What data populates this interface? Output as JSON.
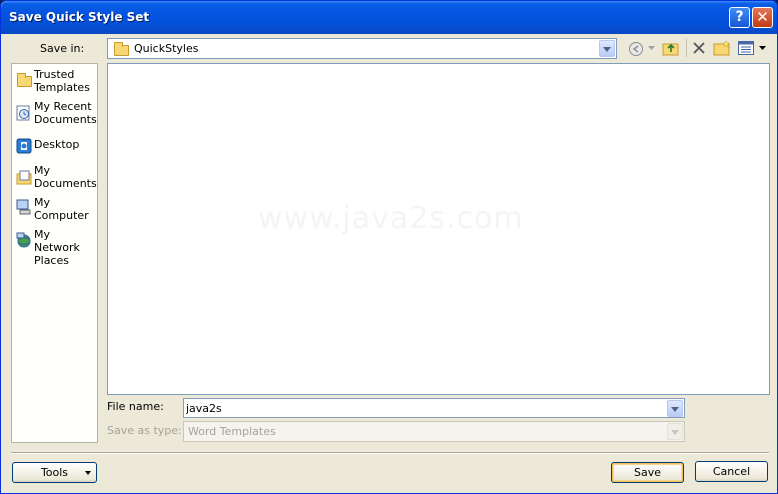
{
  "window": {
    "title": "Save Quick Style Set"
  },
  "titlebar": {
    "help_label": "?",
    "close_label": "✕"
  },
  "save_in": {
    "label": "Save in:",
    "value": "QuickStyles"
  },
  "places": [
    {
      "label": "Trusted Templates",
      "icon": "folder-icon"
    },
    {
      "label": "My Recent Documents",
      "icon": "recent-documents-icon"
    },
    {
      "label": "Desktop",
      "icon": "desktop-icon"
    },
    {
      "label": "My Documents",
      "icon": "my-documents-icon"
    },
    {
      "label": "My Computer",
      "icon": "computer-icon"
    },
    {
      "label": "My Network Places",
      "icon": "network-places-icon"
    }
  ],
  "watermark": "www.java2s.com",
  "file_name": {
    "label": "File name:",
    "value": "java2s"
  },
  "save_as_type": {
    "label": "Save as type:",
    "value": "Word Templates"
  },
  "buttons": {
    "tools": "Tools",
    "save": "Save",
    "cancel": "Cancel"
  },
  "colors": {
    "titlebar": "#0453e0",
    "dialog_bg": "#ece9d8",
    "border": "#7f9db9"
  }
}
